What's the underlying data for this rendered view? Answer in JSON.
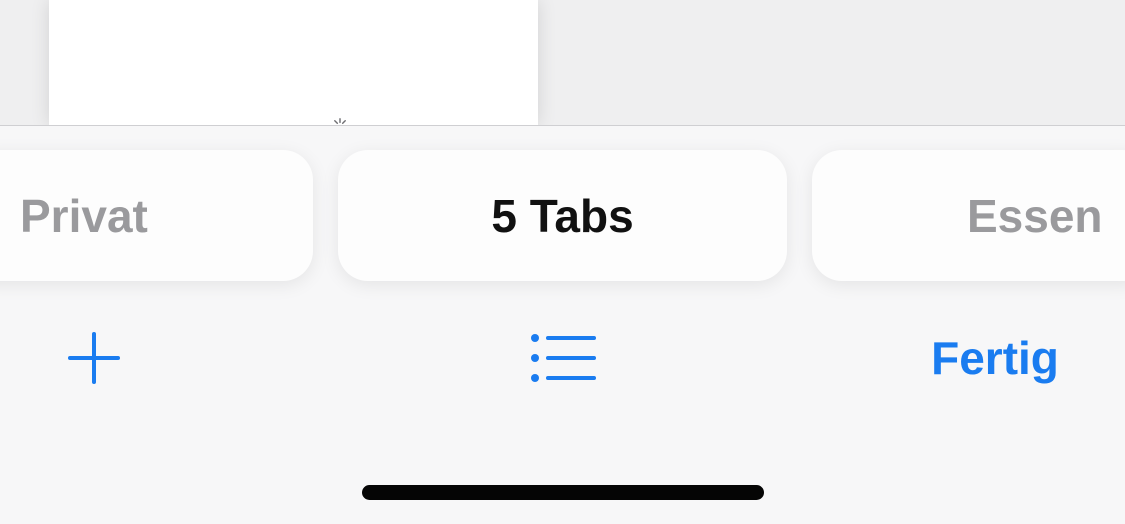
{
  "tab_groups": {
    "left": "Privat",
    "center": "5 Tabs",
    "right": "Essen"
  },
  "toolbar": {
    "new_tab_icon": "plus-icon",
    "tab_groups_icon": "list-icon",
    "done_label": "Fertig"
  },
  "colors": {
    "accent": "#1a7cf0",
    "inactive_text": "#9a9a9d",
    "active_text": "#111111"
  }
}
